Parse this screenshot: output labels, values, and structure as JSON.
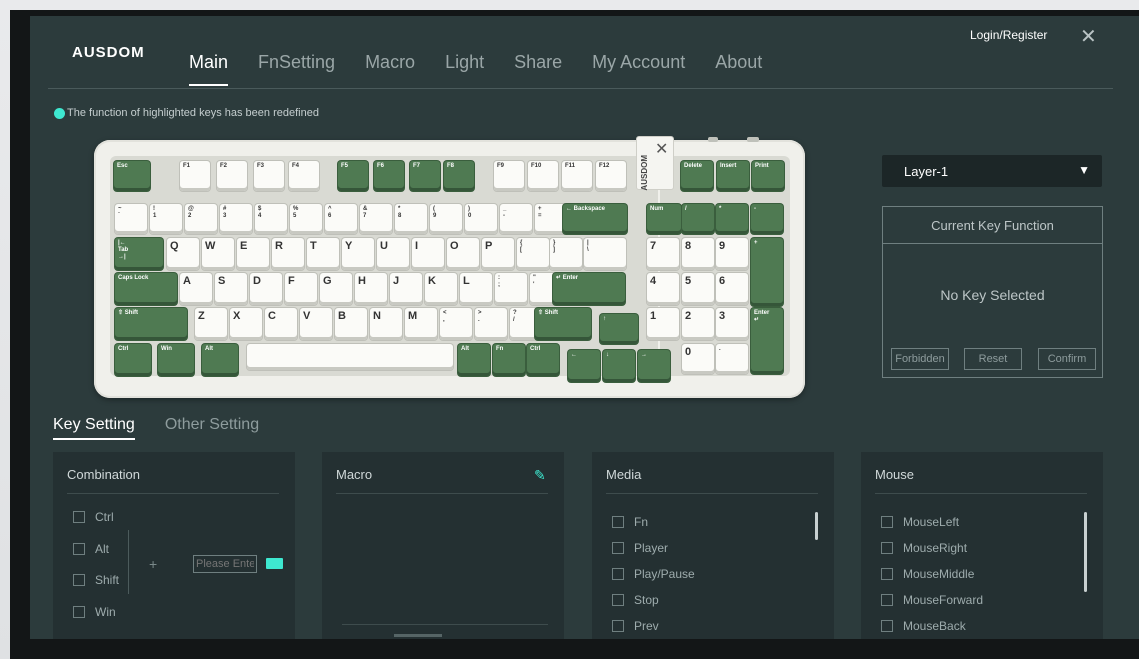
{
  "header": {
    "logo": "AUSDOM",
    "tabs": [
      "Main",
      "FnSetting",
      "Macro",
      "Light",
      "Share",
      "My Account",
      "About"
    ],
    "active_tab": "Main",
    "login": "Login/Register",
    "close": "✕"
  },
  "notice": "The function of highlighted keys has been redefined",
  "keyboard": {
    "badge_text": "AUSDOM",
    "keys": [
      {
        "label": "Esc",
        "style": "g"
      },
      {
        "label": "F1",
        "style": "w"
      },
      {
        "label": "F2",
        "style": "w"
      },
      {
        "label": "F3",
        "style": "w"
      },
      {
        "label": "F4",
        "style": "w"
      },
      {
        "label": "F5",
        "style": "g"
      },
      {
        "label": "F6",
        "style": "g"
      },
      {
        "label": "F7",
        "style": "g"
      },
      {
        "label": "F8",
        "style": "g"
      },
      {
        "label": "F9",
        "style": "w"
      },
      {
        "label": "F10",
        "style": "w"
      },
      {
        "label": "F11",
        "style": "w"
      },
      {
        "label": "F12",
        "style": "w"
      },
      {
        "label": "Delete",
        "style": "g"
      },
      {
        "label": "Insert",
        "style": "g"
      },
      {
        "label": "Print",
        "style": "g"
      },
      {
        "label": "~\n`",
        "style": "w"
      },
      {
        "label": "!\n1",
        "style": "w"
      },
      {
        "label": "@\n2",
        "style": "w"
      },
      {
        "label": "#\n3",
        "style": "w"
      },
      {
        "label": "$\n4",
        "style": "w"
      },
      {
        "label": "%\n5",
        "style": "w"
      },
      {
        "label": "^\n6",
        "style": "w"
      },
      {
        "label": "&\n7",
        "style": "w"
      },
      {
        "label": "*\n8",
        "style": "w"
      },
      {
        "label": "(\n9",
        "style": "w"
      },
      {
        "label": ")\n0",
        "style": "w"
      },
      {
        "label": "_\n-",
        "style": "w"
      },
      {
        "label": "+\n=",
        "style": "w"
      },
      {
        "label": "← Backspace",
        "style": "g"
      },
      {
        "label": "Num",
        "style": "g"
      },
      {
        "label": "/",
        "style": "g"
      },
      {
        "label": "*",
        "style": "g"
      },
      {
        "label": "-",
        "style": "g"
      },
      {
        "label": "|←\nTab\n→|",
        "style": "g"
      },
      {
        "label": "Q",
        "style": "w"
      },
      {
        "label": "W",
        "style": "w"
      },
      {
        "label": "E",
        "style": "w"
      },
      {
        "label": "R",
        "style": "w"
      },
      {
        "label": "T",
        "style": "w"
      },
      {
        "label": "Y",
        "style": "w"
      },
      {
        "label": "U",
        "style": "w"
      },
      {
        "label": "I",
        "style": "w"
      },
      {
        "label": "O",
        "style": "w"
      },
      {
        "label": "P",
        "style": "w"
      },
      {
        "label": "{\n[",
        "style": "w"
      },
      {
        "label": "}\n]",
        "style": "w"
      },
      {
        "label": "|\n\\",
        "style": "w"
      },
      {
        "label": "7",
        "style": "w"
      },
      {
        "label": "8",
        "style": "w"
      },
      {
        "label": "9",
        "style": "w"
      },
      {
        "label": "+",
        "style": "g"
      },
      {
        "label": "Caps Lock",
        "style": "g"
      },
      {
        "label": "A",
        "style": "w"
      },
      {
        "label": "S",
        "style": "w"
      },
      {
        "label": "D",
        "style": "w"
      },
      {
        "label": "F",
        "style": "w"
      },
      {
        "label": "G",
        "style": "w"
      },
      {
        "label": "H",
        "style": "w"
      },
      {
        "label": "J",
        "style": "w"
      },
      {
        "label": "K",
        "style": "w"
      },
      {
        "label": "L",
        "style": "w"
      },
      {
        "label": ":\n;",
        "style": "w"
      },
      {
        "label": "\"\n'",
        "style": "w"
      },
      {
        "label": "↵ Enter",
        "style": "g"
      },
      {
        "label": "4",
        "style": "w"
      },
      {
        "label": "5",
        "style": "w"
      },
      {
        "label": "6",
        "style": "w"
      },
      {
        "label": "⇧ Shift",
        "style": "g"
      },
      {
        "label": "Z",
        "style": "w"
      },
      {
        "label": "X",
        "style": "w"
      },
      {
        "label": "C",
        "style": "w"
      },
      {
        "label": "V",
        "style": "w"
      },
      {
        "label": "B",
        "style": "w"
      },
      {
        "label": "N",
        "style": "w"
      },
      {
        "label": "M",
        "style": "w"
      },
      {
        "label": "<\n,",
        "style": "w"
      },
      {
        "label": ">\n.",
        "style": "w"
      },
      {
        "label": "?\n/",
        "style": "w"
      },
      {
        "label": "⇧ Shift",
        "style": "g"
      },
      {
        "label": "↑",
        "style": "g"
      },
      {
        "label": "1",
        "style": "w"
      },
      {
        "label": "2",
        "style": "w"
      },
      {
        "label": "3",
        "style": "w"
      },
      {
        "label": "Enter\n↵",
        "style": "g"
      },
      {
        "label": "Ctrl",
        "style": "g"
      },
      {
        "label": "Win",
        "style": "g"
      },
      {
        "label": "Alt",
        "style": "g"
      },
      {
        "label": "",
        "style": "w"
      },
      {
        "label": "Alt",
        "style": "g"
      },
      {
        "label": "Fn",
        "style": "g"
      },
      {
        "label": "Ctrl",
        "style": "g"
      },
      {
        "label": "←",
        "style": "g"
      },
      {
        "label": "↓",
        "style": "g"
      },
      {
        "label": "→",
        "style": "g"
      },
      {
        "label": "0",
        "style": "w"
      },
      {
        "label": ".",
        "style": "w"
      }
    ]
  },
  "layer": {
    "value": "Layer-1",
    "arrow": "▼"
  },
  "current_key": {
    "title": "Current Key Function",
    "status": "No Key Selected",
    "buttons": [
      "Forbidden",
      "Reset",
      "Confirm"
    ]
  },
  "subtabs": [
    "Key Setting",
    "Other Setting"
  ],
  "panels": {
    "combination": {
      "title": "Combination",
      "options": [
        "Ctrl",
        "Alt",
        "Shift",
        "Win"
      ],
      "plus": "+",
      "input_placeholder": "Please Enter"
    },
    "macro": {
      "title": "Macro"
    },
    "media": {
      "title": "Media",
      "options": [
        "Fn",
        "Player",
        "Play/Pause",
        "Stop",
        "Prev"
      ]
    },
    "mouse": {
      "title": "Mouse",
      "options": [
        "MouseLeft",
        "MouseRight",
        "MouseMiddle",
        "MouseForward",
        "MouseBack"
      ]
    }
  }
}
